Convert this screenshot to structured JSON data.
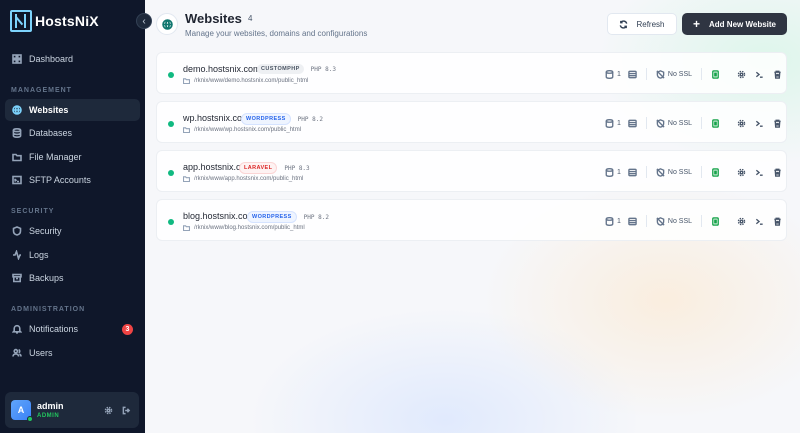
{
  "app": {
    "name": "HostsNiX"
  },
  "sidebar": {
    "dashboard": "Dashboard",
    "sections": {
      "management": "MANAGEMENT",
      "security": "SECURITY",
      "administration": "ADMINISTRATION"
    },
    "items": {
      "websites": "Websites",
      "databases": "Databases",
      "file_manager": "File Manager",
      "sftp": "SFTP Accounts",
      "security": "Security",
      "logs": "Logs",
      "backups": "Backups",
      "notifications": "Notifications",
      "users": "Users"
    },
    "notifications_badge": "3",
    "user": {
      "initial": "A",
      "name": "admin",
      "role": "ADMIN"
    }
  },
  "header": {
    "title": "Websites",
    "count": "4",
    "subtitle": "Manage your websites, domains and configurations",
    "refresh_label": "Refresh",
    "add_label": "Add New Website"
  },
  "websites": [
    {
      "domain": "demo.hostsnix.com",
      "type": "CUSTOMPHP",
      "php": "PHP 8.3",
      "path": "/rknix/www/demo.hostsnix.com/public_html",
      "db_count": "1",
      "ssl": "No SSL",
      "status": "active"
    },
    {
      "domain": "wp.hostsnix.com",
      "type": "WORDPRESS",
      "php": "PHP 8.2",
      "path": "/rknix/www/wp.hostsnix.com/public_html",
      "db_count": "1",
      "ssl": "No SSL",
      "status": "active"
    },
    {
      "domain": "app.hostsnix.com",
      "type": "LARAVEL",
      "php": "PHP 8.3",
      "path": "/rknix/www/app.hostsnix.com/public_html",
      "db_count": "1",
      "ssl": "No SSL",
      "status": "active"
    },
    {
      "domain": "blog.hostsnix.com",
      "type": "WORDPRESS",
      "php": "PHP 8.2",
      "path": "/rknix/www/blog.hostsnix.com/public_html",
      "db_count": "1",
      "ssl": "No SSL",
      "status": "active"
    }
  ],
  "colors": {
    "sidebar_bg": "#0f172a",
    "accent": "#7dd3fc",
    "status_active": "#10b981",
    "primary_button": "#2f3542"
  }
}
